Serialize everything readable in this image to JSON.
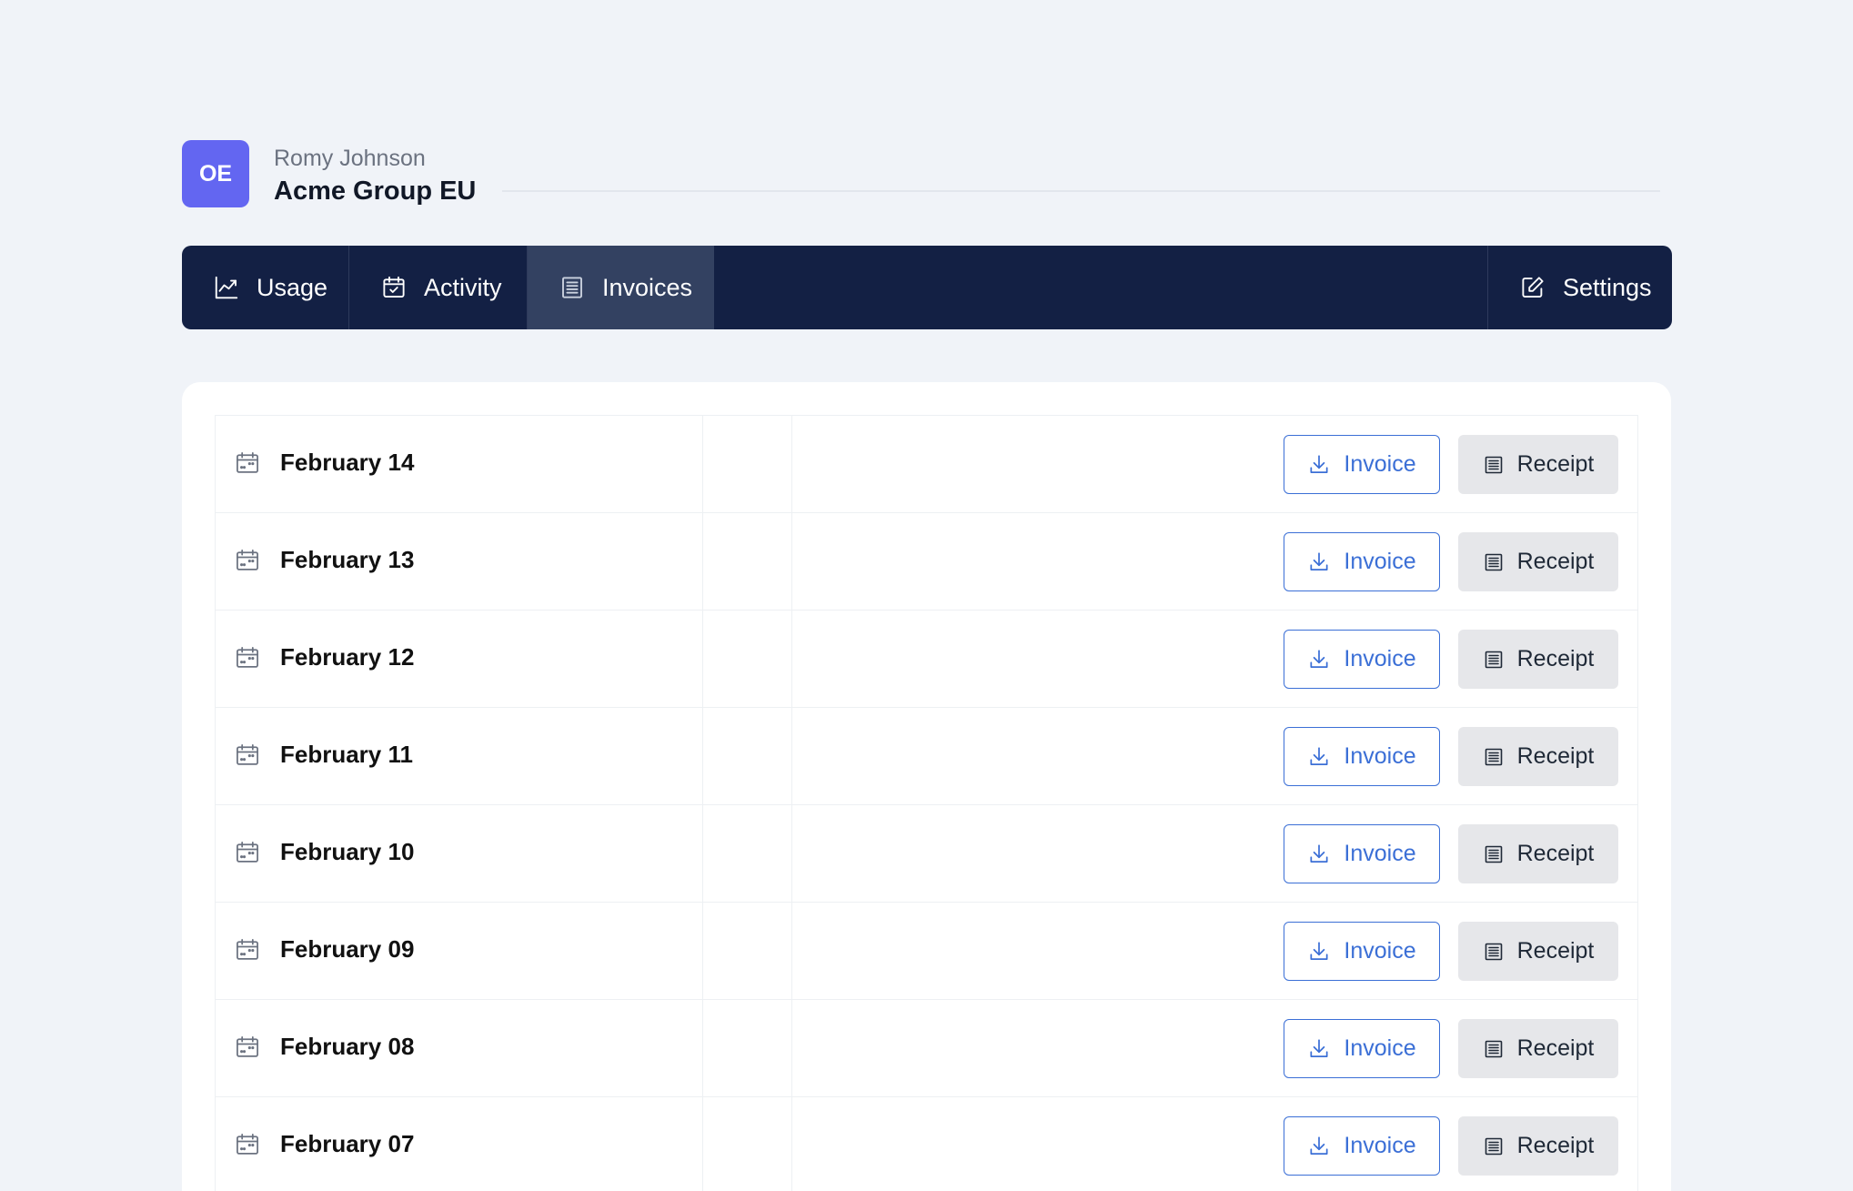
{
  "header": {
    "avatar_initials": "OE",
    "user_name": "Romy Johnson",
    "org_name": "Acme Group EU",
    "avatar_color": "#6366f1"
  },
  "nav": {
    "tabs": [
      {
        "label": "Usage",
        "icon": "chart-line-icon"
      },
      {
        "label": "Activity",
        "icon": "calendar-check-icon"
      },
      {
        "label": "Invoices",
        "icon": "receipt-icon",
        "active": true
      }
    ],
    "settings_label": "Settings",
    "settings_icon": "edit-icon",
    "background": "#132044",
    "active_background": "#334161"
  },
  "invoices": {
    "rows": [
      {
        "date": "February 14",
        "invoice_label": "Invoice",
        "receipt_label": "Receipt"
      },
      {
        "date": "February 13",
        "invoice_label": "Invoice",
        "receipt_label": "Receipt"
      },
      {
        "date": "February 12",
        "invoice_label": "Invoice",
        "receipt_label": "Receipt"
      },
      {
        "date": "February 11",
        "invoice_label": "Invoice",
        "receipt_label": "Receipt"
      },
      {
        "date": "February 10",
        "invoice_label": "Invoice",
        "receipt_label": "Receipt"
      },
      {
        "date": "February 09",
        "invoice_label": "Invoice",
        "receipt_label": "Receipt"
      },
      {
        "date": "February 08",
        "invoice_label": "Invoice",
        "receipt_label": "Receipt"
      },
      {
        "date": "February 07",
        "invoice_label": "Invoice",
        "receipt_label": "Receipt"
      }
    ],
    "accent_color": "#3b6fd6"
  }
}
